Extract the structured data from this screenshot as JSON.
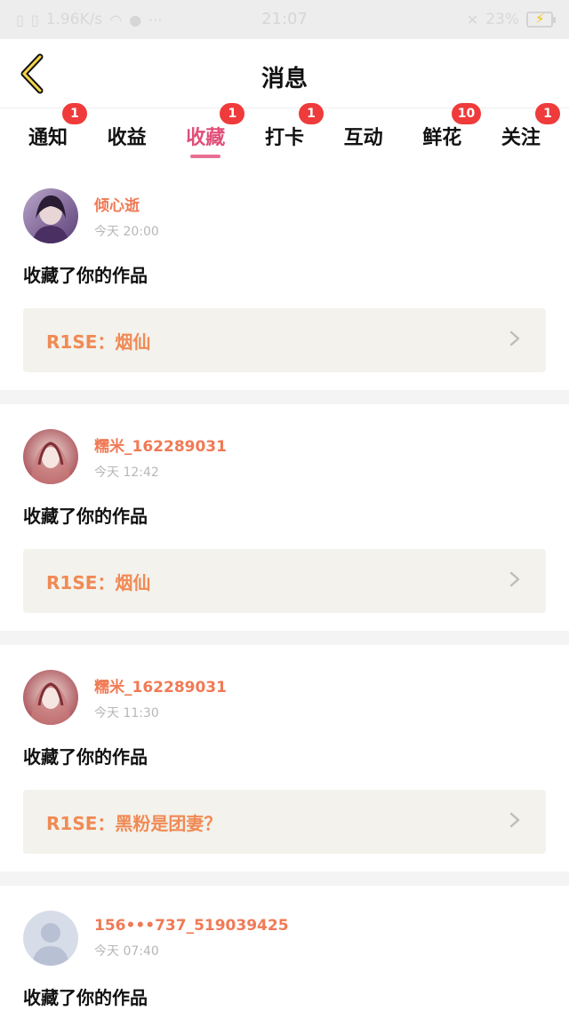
{
  "status_bar": {
    "network_speed": "1.96K/s",
    "time": "21:07",
    "battery": "23%"
  },
  "header": {
    "back_icon": "chevron-left-icon",
    "title": "消息"
  },
  "tabs": [
    {
      "label": "通知",
      "badge": "1",
      "active": false
    },
    {
      "label": "收益",
      "badge": "",
      "active": false
    },
    {
      "label": "收藏",
      "badge": "1",
      "active": true
    },
    {
      "label": "打卡",
      "badge": "1",
      "active": false
    },
    {
      "label": "互动",
      "badge": "",
      "active": false
    },
    {
      "label": "鲜花",
      "badge": "10",
      "active": false
    },
    {
      "label": "关注",
      "badge": "1",
      "active": false
    }
  ],
  "messages": [
    {
      "avatar": "avatar-purple",
      "name": "倾心逝",
      "time": "今天 20:00",
      "action": "收藏了你的作品",
      "work_title": "R1SE：烟仙"
    },
    {
      "avatar": "avatar-pink",
      "name": "糯米_162289031",
      "time": "今天 12:42",
      "action": "收藏了你的作品",
      "work_title": "R1SE：烟仙"
    },
    {
      "avatar": "avatar-pink",
      "name": "糯米_162289031",
      "time": "今天 11:30",
      "action": "收藏了你的作品",
      "work_title": "R1SE：黑粉是团妻？"
    },
    {
      "avatar": "avatar-default",
      "name": "156•••737_519039425",
      "time": "今天 07:40",
      "action": "收藏了你的作品",
      "work_title": ""
    }
  ],
  "colors": {
    "accent_pink": "#e86e94",
    "name_orange": "#f07a55",
    "badge_red": "#ef3b3b",
    "work_bg": "#f3f2ec"
  }
}
